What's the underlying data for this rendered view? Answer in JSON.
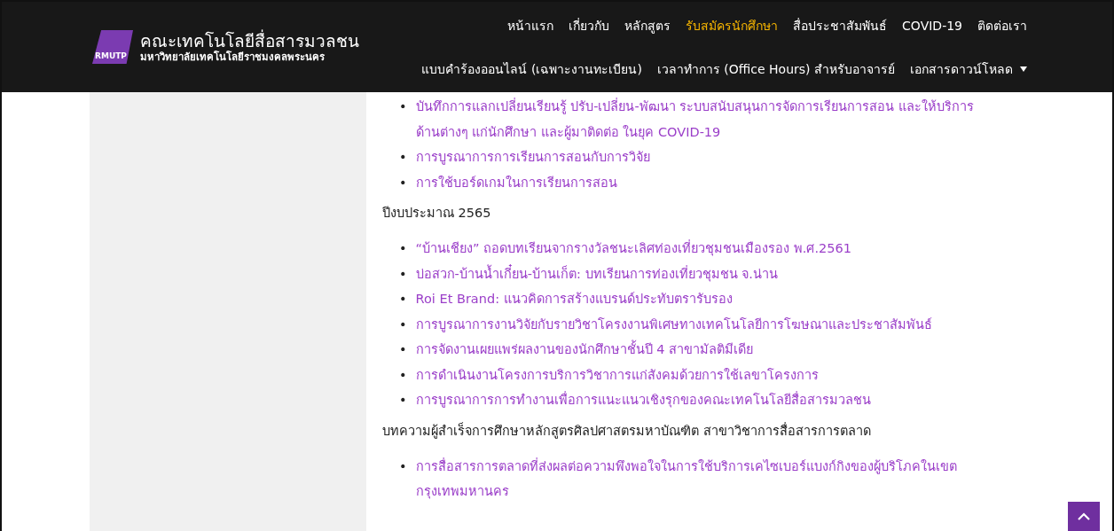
{
  "header": {
    "logo_text": "RMUTP",
    "title": "คณะเทคโนโลยีสื่อสารมวลชน",
    "subtitle": "มหาวิทยาลัยเทคโนโลยีราชมงคลพระนคร",
    "nav_primary": [
      {
        "label": "หน้าแรก",
        "selected": false
      },
      {
        "label": "เกี่ยวกับ",
        "selected": false
      },
      {
        "label": "หลักสูตร",
        "selected": false
      },
      {
        "label": "รับสมัครนักศึกษา",
        "selected": true
      },
      {
        "label": "สื่อประชาสัมพันธ์",
        "selected": false
      },
      {
        "label": "COVID-19",
        "selected": false
      },
      {
        "label": "ติดต่อเรา",
        "selected": false
      }
    ],
    "nav_secondary": [
      {
        "label": "แบบคำร้องออนไลน์ (เฉพาะงานทะเบียน)",
        "dropdown": false
      },
      {
        "label": "เวลาทำการ (Office Hours) สำหรับอาจารย์",
        "dropdown": false
      },
      {
        "label": "เอกสารดาวน์โหลด",
        "dropdown": true
      }
    ]
  },
  "sections": [
    {
      "items": [
        {
          "bullet": "•",
          "text": "บันทึกการแลกเปลี่ยนเรียนรู้ ปรับ-เปลี่ยน-พัฒนา ระบบสนับสนุนการจัดการเรียนการสอน และให้บริการด้านต่างๆ แก่นักศึกษา และผู้มาติดต่อ ในยุค COVID-19"
        },
        {
          "bullet": "•",
          "text": "การบูรณาการการเรียนการสอนกับการวิจัย"
        },
        {
          "bullet": "•",
          "text": "การใช้บอร์ดเกมในการเรียนการสอน"
        }
      ]
    },
    {
      "heading": "ปีงบประมาณ 2565",
      "items": [
        {
          "bullet": "•",
          "text": "“บ้านเชียง” ถอดบทเรียนจากรางวัลชนะเลิศท่องเที่ยวชุมชนเมืองรอง พ.ศ.2561"
        },
        {
          "bullet": "•",
          "text": "บ่อสวก-บ้านน้ำเกี๋ยน-บ้านเก็ต: บทเรียนการท่องเที่ยวชุมชน จ.น่าน"
        },
        {
          "bullet": "•",
          "text": "Roi Et Brand: แนวคิดการสร้างแบรนด์ประทับตรารับรอง"
        },
        {
          "bullet": "•",
          "text": "การบูรณาการงานวิจัยกับรายวิชาโครงงานพิเศษทางเทคโนโลยีการโฆษณาและประชาสัมพันธ์"
        },
        {
          "bullet": "•",
          "text": "การจัดงานเผยแพร่ผลงานของนักศึกษาชั้นปี 4 สาขามัลติมีเดีย"
        },
        {
          "bullet": "•",
          "text": "การดำเนินงานโครงการบริการวิชาการแก่สังคมด้วยการใช้เลขาโครงการ"
        },
        {
          "bullet": "•",
          "text": "การบูรณาการการทำงานเพื่อการแนะแนวเชิงรุกของคณะเทคโนโลยีสื่อสารมวลชน"
        }
      ]
    },
    {
      "heading": "บทความผู้สำเร็จการศึกษาหลักสูตรศิลปศาสตรมหาบัณฑิต สาขาวิชาการสื่อสารการตลาด",
      "items": [
        {
          "bullet": "•",
          "text": "การสื่อสารการตลาดที่ส่งผลต่อความพึงพอใจในการใช้บริการเคไซเบอร์แบงก์กิงของผู้บริโภคในเขตกรุงเทพมหานคร"
        }
      ]
    }
  ]
}
